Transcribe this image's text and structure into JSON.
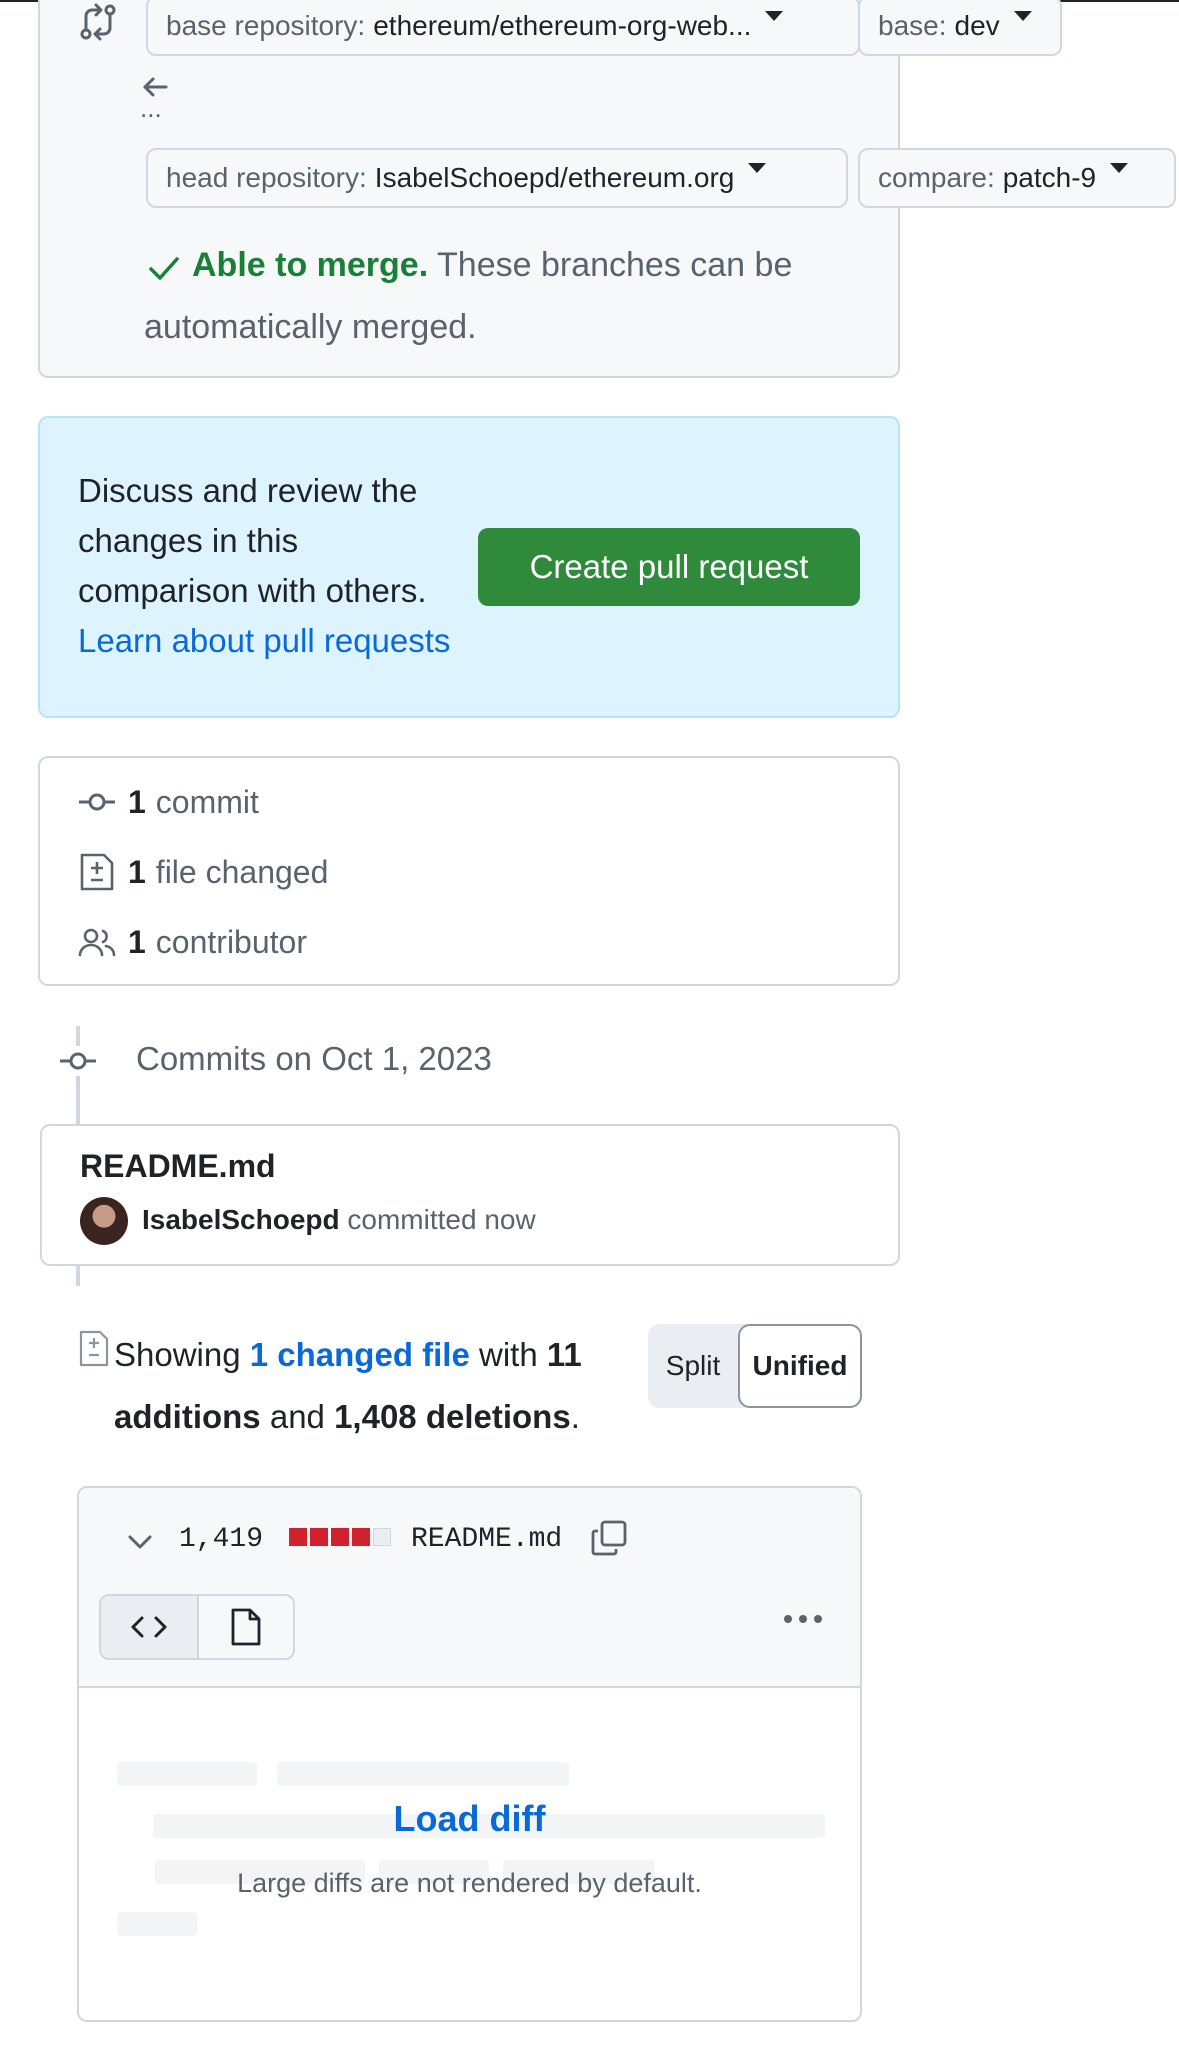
{
  "compare": {
    "base_repo_label": "base repository:",
    "base_repo_value": "ethereum/ethereum-org-web...",
    "base_label": "base:",
    "base_value": "dev",
    "ellipsis": "...",
    "head_repo_label": "head repository:",
    "head_repo_value": "IsabelSchoepd/ethereum.org",
    "compare_label": "compare:",
    "compare_value": "patch-9",
    "merge_status": "Able to merge.",
    "merge_detail_1": "These branches can be",
    "merge_detail_2": "automatically merged."
  },
  "discuss": {
    "line1": "Discuss and review the",
    "line2": "changes in this",
    "line3": "comparison with others.",
    "link": "Learn about pull requests",
    "button": "Create pull request"
  },
  "stats": {
    "commits_count": "1",
    "commits_label": "commit",
    "files_count": "1",
    "files_label": "file changed",
    "contributors_count": "1",
    "contributors_label": "contributor"
  },
  "timeline": {
    "date_label": "Commits on Oct 1, 2023",
    "commit_title": "README.md",
    "author": "IsabelSchoepd",
    "time": "committed now"
  },
  "summary": {
    "showing": "Showing",
    "changed_link": "1 changed file",
    "with": "with",
    "additions_count": "11",
    "additions_label": "additions",
    "and": "and",
    "deletions": "1,408 deletions",
    "period": ".",
    "split": "Split",
    "unified": "Unified"
  },
  "file": {
    "changes": "1,419",
    "name": "README.md",
    "load_diff": "Load diff",
    "note": "Large diffs are not rendered by default."
  },
  "colors": {
    "accent_green": "#2f8a3b",
    "link_blue": "#0969da",
    "deletion_red": "#cf222e"
  }
}
